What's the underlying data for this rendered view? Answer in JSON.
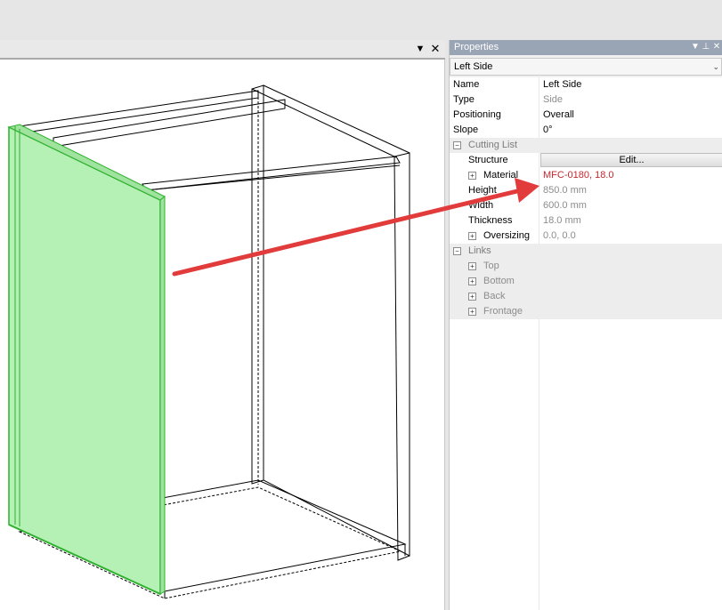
{
  "viewport": {
    "dropdown_icon": "triangle-down-icon",
    "close_icon": "close-icon"
  },
  "properties": {
    "title": "Properties",
    "object_selector": "Left Side",
    "rows": {
      "name": {
        "label": "Name",
        "value": "Left Side"
      },
      "type": {
        "label": "Type",
        "value": "Side"
      },
      "positioning": {
        "label": "Positioning",
        "value": "Overall"
      },
      "slope": {
        "label": "Slope",
        "value": "0°"
      },
      "cutting_list": {
        "label": "Cutting List"
      },
      "structure": {
        "label": "Structure",
        "button": "Edit..."
      },
      "material": {
        "label": "Material",
        "value": "MFC-0180, 18.0"
      },
      "height": {
        "label": "Height",
        "value": "850.0 mm"
      },
      "width": {
        "label": "Width",
        "value": "600.0 mm"
      },
      "thickness": {
        "label": "Thickness",
        "value": "18.0 mm"
      },
      "oversizing": {
        "label": "Oversizing",
        "value": "0.0, 0.0"
      },
      "links": {
        "label": "Links"
      },
      "top": {
        "label": "Top"
      },
      "bottom": {
        "label": "Bottom"
      },
      "back": {
        "label": "Back"
      },
      "frontage": {
        "label": "Frontage"
      }
    }
  },
  "colors": {
    "highlight_panel": "#b5f0b5",
    "highlight_edge": "#2fb12f",
    "arrow": "#e23b3b",
    "title_bar": "#99a4b4",
    "material_value": "#c3282f"
  }
}
